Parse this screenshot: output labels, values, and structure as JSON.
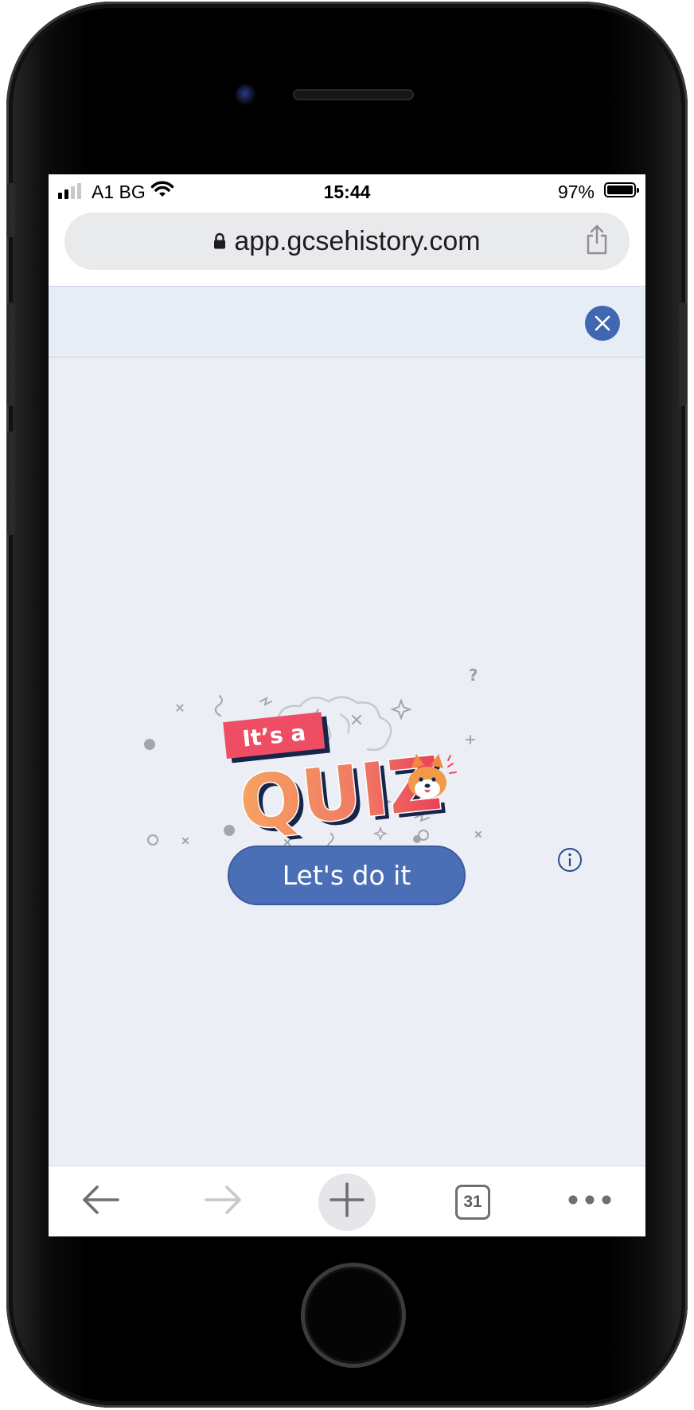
{
  "status_bar": {
    "carrier": "A1 BG",
    "time": "15:44",
    "battery_percent": "97%",
    "battery_level": 0.97,
    "signal_bars": 2,
    "signal_total": 4
  },
  "browser": {
    "url": "app.gcsehistory.com",
    "tab_count": "31"
  },
  "quiz": {
    "logo_top_text": "It’s a",
    "logo_main_text": "QUIZ",
    "cta_label": "Let's do it"
  },
  "colors": {
    "accent": "#3f67b2",
    "cta": "#4b6fb7",
    "page_background": "#ebeff5",
    "quiz_pink": "#ee4d63",
    "quiz_orange": "#f6a261"
  },
  "icons": [
    "lock-icon",
    "share-icon",
    "close-icon",
    "info-icon",
    "back-arrow-icon",
    "forward-arrow-icon",
    "plus-icon",
    "tabs-icon",
    "more-icon",
    "wifi-icon",
    "battery-icon",
    "signal-icon"
  ]
}
